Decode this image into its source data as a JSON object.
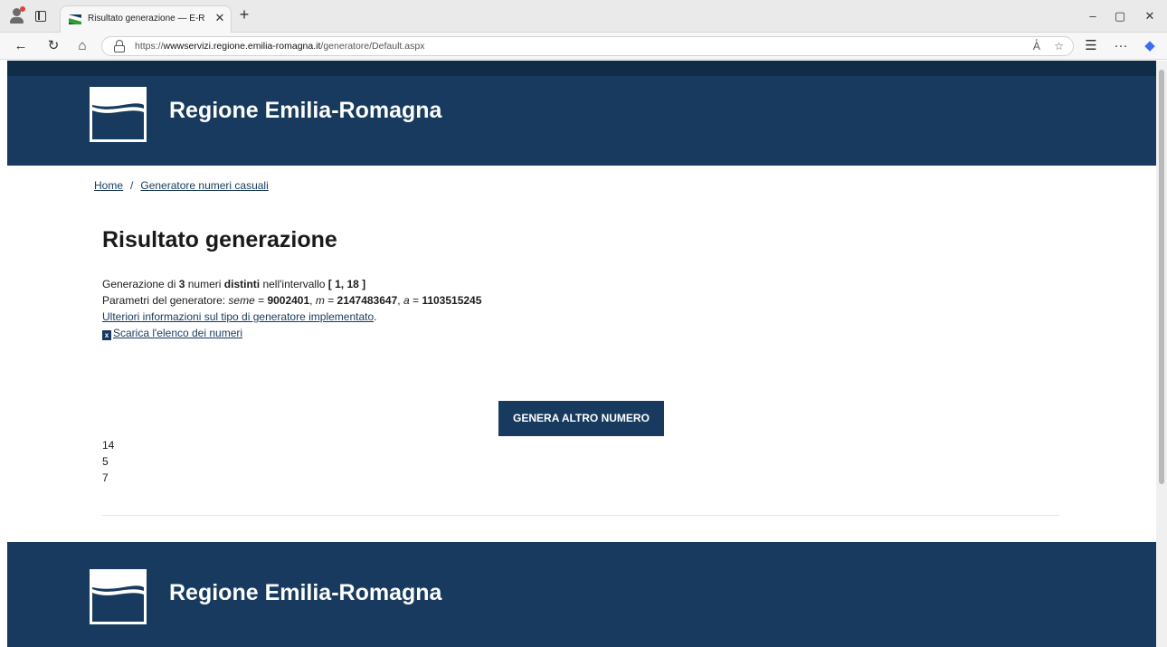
{
  "browser": {
    "tab_title": "Risultato generazione — E-R Il po",
    "tab_close": "✕",
    "new_tab": "+",
    "url_prefix": "https://",
    "url_host": "wwwservizi.regione.emilia-romagna.it",
    "url_path": "/generatore/Default.aspx",
    "read_aloud": "A̔",
    "controls": {
      "minimize": "–",
      "maximize": "▢",
      "close": "✕"
    },
    "nav": {
      "back": "←",
      "refresh": "↻",
      "home": "⌂"
    },
    "toolbar": {
      "favorites": "☆",
      "collections": "☰",
      "more": "···"
    }
  },
  "header": {
    "site_title": "Regione Emilia-Romagna"
  },
  "breadcrumb": {
    "home": "Home",
    "separator": "/",
    "current": "Generatore numeri casuali"
  },
  "main": {
    "title": "Risultato generazione",
    "line1": {
      "a": "Generazione di ",
      "count": "3",
      "b": " numeri ",
      "distinct": "distinti",
      "c": " nell'intervallo ",
      "range": "[ 1, 18 ]"
    },
    "line2": {
      "a": "Parametri del generatore: ",
      "seed_label": "seme",
      "eq1": " = ",
      "seed": "9002401",
      "sep1": ", ",
      "m_label": "m",
      "eq2": " = ",
      "m": "2147483647",
      "sep2": ", ",
      "a_label": "a",
      "eq3": " = ",
      "a_value": "1103515245"
    },
    "info_link": "Ulteriori informazioni sul tipo di generatore implementato",
    "info_link_suffix": ".",
    "download_icon": "x",
    "download_link": "Scarica l'elenco dei numeri",
    "button_label": "GENERA ALTRO NUMERO",
    "numbers": [
      "14",
      "5",
      "7"
    ]
  },
  "footer": {
    "site_title": "Regione Emilia-Romagna"
  },
  "colors": {
    "brand_blue": "#173a5e",
    "top_strip": "#112c47"
  }
}
